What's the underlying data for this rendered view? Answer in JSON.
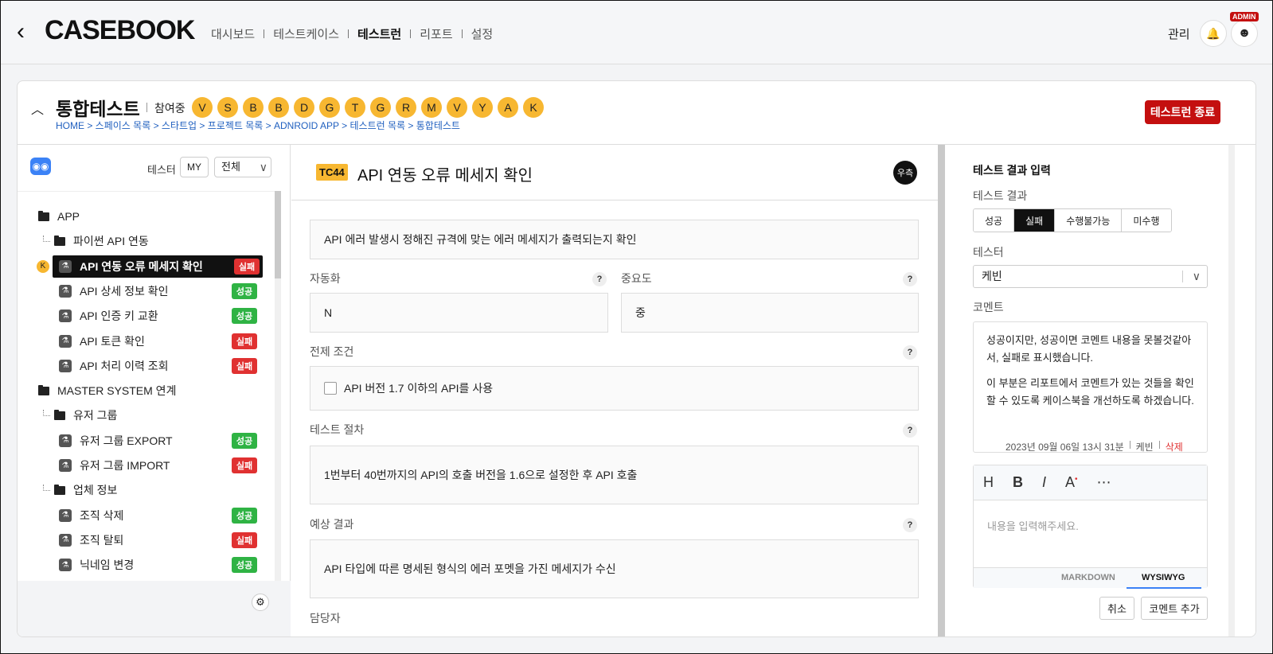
{
  "topbar": {
    "logo": "CASEBOOK",
    "nav": [
      "대시보드",
      "테스트케이스",
      "테스트런",
      "리포트",
      "설정"
    ],
    "active_nav": "테스트런",
    "manage": "관리",
    "admin_badge": "ADMIN"
  },
  "run": {
    "title": "통합테스트",
    "participants_label": "참여중",
    "participants": [
      "V",
      "S",
      "B",
      "B",
      "D",
      "G",
      "T",
      "G",
      "R",
      "M",
      "V",
      "Y",
      "A",
      "K"
    ],
    "breadcrumb": "HOME > 스페이스 목록 > 스타트업 > 프로젝트 목록 > ADNROID APP > 테스트런 목록 > 통합테스트",
    "end_button": "테스트런 종료"
  },
  "left": {
    "tester_label": "테스터",
    "my_label": "MY",
    "filter_value": "전체",
    "tree": [
      {
        "type": "folder",
        "depth": 0,
        "label": "APP"
      },
      {
        "type": "folder",
        "depth": 1,
        "label": "파이썬 API 연동"
      },
      {
        "type": "case",
        "depth": 2,
        "label": "API 연동 오류 메세지 확인",
        "status": "실패",
        "selected": true,
        "assignee": "K"
      },
      {
        "type": "case",
        "depth": 2,
        "label": "API 상세 정보 확인",
        "status": "성공"
      },
      {
        "type": "case",
        "depth": 2,
        "label": "API 인증 키 교환",
        "status": "성공"
      },
      {
        "type": "case",
        "depth": 2,
        "label": "API 토큰 확인",
        "status": "실패"
      },
      {
        "type": "case",
        "depth": 2,
        "label": "API 처리 이력 조회",
        "status": "실패"
      },
      {
        "type": "folder",
        "depth": 0,
        "label": "MASTER SYSTEM 연계"
      },
      {
        "type": "folder",
        "depth": 1,
        "label": "유저 그룹"
      },
      {
        "type": "case",
        "depth": 2,
        "label": "유저 그룹 EXPORT",
        "status": "성공"
      },
      {
        "type": "case",
        "depth": 2,
        "label": "유저 그룹 IMPORT",
        "status": "실패"
      },
      {
        "type": "folder",
        "depth": 1,
        "label": "업체 정보"
      },
      {
        "type": "case",
        "depth": 2,
        "label": "조직 삭제",
        "status": "성공"
      },
      {
        "type": "case",
        "depth": 2,
        "label": "조직 탈퇴",
        "status": "실패"
      },
      {
        "type": "case",
        "depth": 2,
        "label": "닉네임 변경",
        "status": "성공"
      }
    ]
  },
  "testcase": {
    "id": "TC44",
    "title": "API 연동 오류 메세지 확인",
    "priority_badge": "우측",
    "description": "API 에러 발생시 정해진 규격에 맞는 에러 메세지가 출력되는지 확인",
    "automation_label": "자동화",
    "automation_value": "N",
    "importance_label": "중요도",
    "importance_value": "중",
    "precondition_label": "전제 조건",
    "precondition_item": "API 버전 1.7 이하의 API를 사용",
    "steps_label": "테스트 절차",
    "steps_value": "1번부터 40번까지의 API의 호출 버전을 1.6으로 설정한 후 API 호출",
    "expected_label": "예상 결과",
    "expected_value": "API 타입에 따른 명세된 형식의 에러 포멧을 가진 메세지가 수신",
    "owner_label": "담당자",
    "help": "?"
  },
  "result": {
    "title": "테스트 결과 입력",
    "result_label": "테스트 결과",
    "options": [
      "성공",
      "실패",
      "수행불가능",
      "미수행"
    ],
    "selected": "실패",
    "tester_label": "테스터",
    "tester_value": "케빈",
    "comment_label": "코멘트",
    "comment_p1": "성공이지만, 성공이면 코멘트 내용을 못볼것같아서, 실패로 표시했습니다.",
    "comment_p2": "이 부분은 리포트에서 코멘트가 있는 것들을 확인할 수 있도록 케이스북을 개선하도록 하겠습니다.",
    "comment_date": "2023년 09월 06일 13시 31분",
    "comment_author": "케빈",
    "comment_delete": "삭제",
    "editor_placeholder": "내용을 입력해주세요.",
    "editor_tabs": [
      "MARKDOWN",
      "WYSIWYG"
    ],
    "cancel": "취소",
    "add": "코멘트 추가"
  }
}
